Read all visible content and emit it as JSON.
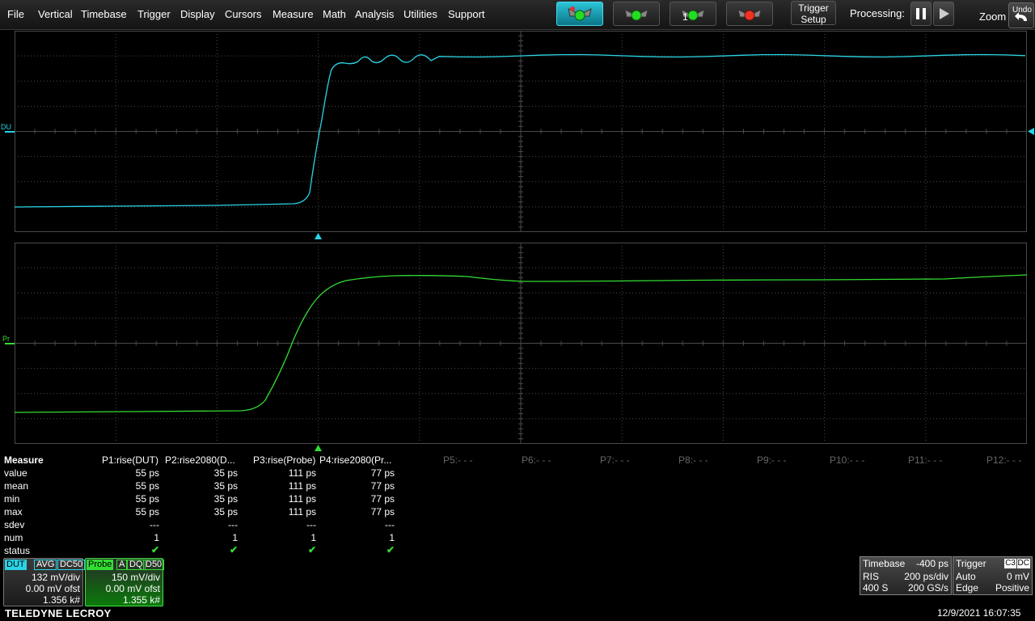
{
  "menu": {
    "items": [
      "File",
      "Vertical",
      "Timebase",
      "Trigger",
      "Display",
      "Cursors",
      "Measure",
      "Math",
      "Analysis",
      "Utilities",
      "Support"
    ],
    "trigger_setup": [
      "Trigger",
      "Setup"
    ],
    "processing_label": "Processing:",
    "zoom_label": "Zoom",
    "undo_label": "Undo",
    "single_button_label": "1"
  },
  "colors": {
    "dut_trace": "#2ad4e6",
    "probe_trace": "#33dd33",
    "grid": "#4a4a4a",
    "background": "#000000"
  },
  "channels": {
    "dut": {
      "axis_label": "DU",
      "tag": "DUT",
      "badges": [
        "AVG",
        "DC50"
      ],
      "vdiv": "132 mV/div",
      "offset": "0.00 mV ofst",
      "count": "1.356 k#"
    },
    "probe": {
      "axis_label": "Pr",
      "tag": "Probe",
      "badges": [
        "A",
        "DQ",
        "D50"
      ],
      "vdiv": "150 mV/div",
      "offset": "0.00 mV ofst",
      "count": "1.355 k#"
    }
  },
  "measure": {
    "title": "Measure",
    "headers": [
      "P1:rise(DUT)",
      "P2:rise2080(D...",
      "P3:rise(Probe)",
      "P4:rise2080(Pr...",
      "P5:- - -",
      "P6:- - -",
      "P7:- - -",
      "P8:- - -",
      "P9:- - -",
      "P10:- - -",
      "P11:- - -",
      "P12:- - -"
    ],
    "row_labels": [
      "value",
      "mean",
      "min",
      "max",
      "sdev",
      "num",
      "status"
    ],
    "rows": {
      "value": [
        "55 ps",
        "35 ps",
        "111 ps",
        "77 ps"
      ],
      "mean": [
        "55 ps",
        "35 ps",
        "111 ps",
        "77 ps"
      ],
      "min": [
        "55 ps",
        "35 ps",
        "111 ps",
        "77 ps"
      ],
      "max": [
        "55 ps",
        "35 ps",
        "111 ps",
        "77 ps"
      ],
      "sdev": [
        "---",
        "---",
        "---",
        "---"
      ],
      "num": [
        "1",
        "1",
        "1",
        "1"
      ],
      "status": [
        "✔",
        "✔",
        "✔",
        "✔"
      ]
    }
  },
  "timebase": {
    "label": "Timebase",
    "delay": "-400 ps",
    "mode": "RIS",
    "tdiv": "200 ps/div",
    "samples": "400 S",
    "rate": "200 GS/s"
  },
  "trigger": {
    "label": "Trigger",
    "badges": [
      "C3",
      "DC"
    ],
    "mode": "Auto",
    "level": "0 mV",
    "type": "Edge",
    "slope": "Positive"
  },
  "brand": "TELEDYNE LECROY",
  "datetime": "12/9/2021 16:07:35"
}
